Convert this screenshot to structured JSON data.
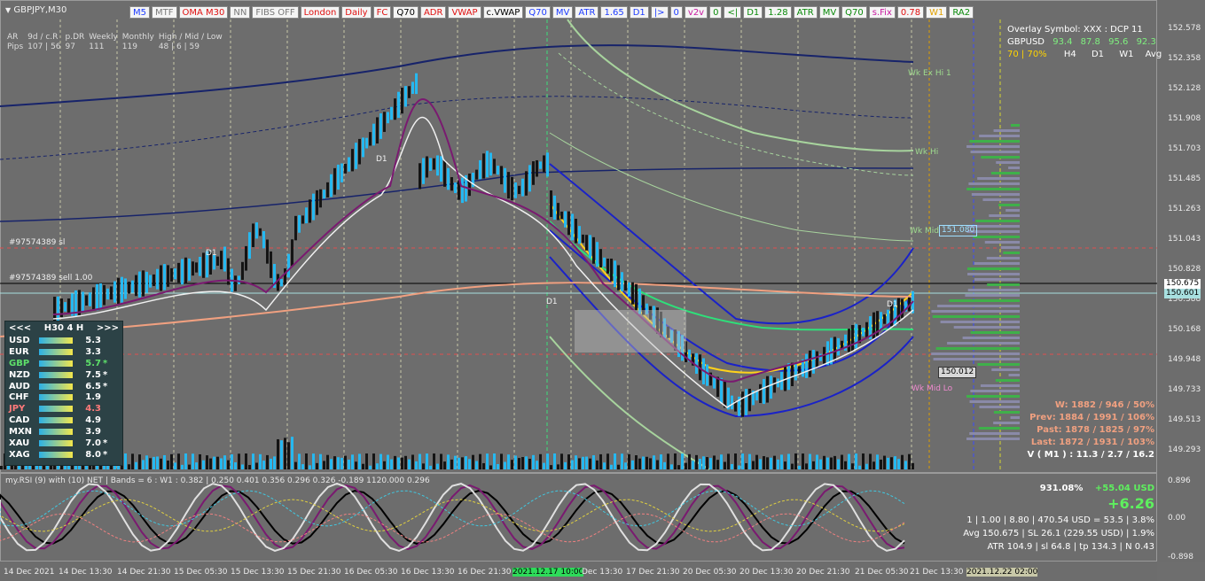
{
  "symbol_title": "GBPJPY,M30",
  "toolbar": [
    {
      "label": "M5",
      "color": "#1e3cff"
    },
    {
      "label": "MTF",
      "color": "#7a7a7a"
    },
    {
      "label": "OMA M30",
      "color": "#e01010"
    },
    {
      "label": "NN",
      "color": "#7a7a7a"
    },
    {
      "label": "FIBS OFF",
      "color": "#7a7a7a"
    },
    {
      "label": "London",
      "color": "#e01010"
    },
    {
      "label": "Daily",
      "color": "#e01010"
    },
    {
      "label": "FC",
      "color": "#e01010"
    },
    {
      "label": "Q70",
      "color": "#000000"
    },
    {
      "label": "ADR",
      "color": "#e01010"
    },
    {
      "label": "VWAP",
      "color": "#e01010"
    },
    {
      "label": "c.VWAP",
      "color": "#000000"
    },
    {
      "label": "Q70",
      "color": "#1e3cff"
    },
    {
      "label": "MV",
      "color": "#1e3cff"
    },
    {
      "label": "ATR",
      "color": "#1e3cff"
    },
    {
      "label": "1.65",
      "color": "#1e3cff"
    },
    {
      "label": "D1",
      "color": "#1e3cff"
    },
    {
      "label": "|>",
      "color": "#1e3cff"
    },
    {
      "label": "0",
      "color": "#1e3cff"
    },
    {
      "label": "v2v",
      "color": "#c81aa0"
    },
    {
      "label": "0",
      "color": "#0a8a0a"
    },
    {
      "label": "<|",
      "color": "#0a8a0a"
    },
    {
      "label": "D1",
      "color": "#0a8a0a"
    },
    {
      "label": "1.28",
      "color": "#0a8a0a"
    },
    {
      "label": "ATR",
      "color": "#0a8a0a"
    },
    {
      "label": "MV",
      "color": "#0a8a0a"
    },
    {
      "label": "Q70",
      "color": "#0a8a0a"
    },
    {
      "label": "s.Fix",
      "color": "#c81aa0"
    },
    {
      "label": "0.78",
      "color": "#e01010"
    },
    {
      "label": "W1",
      "color": "#e0a000"
    },
    {
      "label": "RA2",
      "color": "#0a8a0a"
    }
  ],
  "stats": {
    "headers": [
      "AR",
      "9d / c.R",
      "p.DR",
      "Weekly",
      "Monthly",
      "High / Mid / Low"
    ],
    "row_label": "Pips",
    "values": [
      "107 | 56",
      "97",
      "111",
      "119",
      "48 | 6 | 59"
    ]
  },
  "strength_panel": {
    "prev": "<<<",
    "timeframe": "H30 4 H",
    "next": ">>>",
    "rows": [
      {
        "cur": "USD",
        "val": "5.3",
        "flag": "",
        "color": "#ffffff"
      },
      {
        "cur": "EUR",
        "val": "3.3",
        "flag": "",
        "color": "#ffffff"
      },
      {
        "cur": "GBP",
        "val": "5.7",
        "flag": "*",
        "color": "#5ee06a"
      },
      {
        "cur": "NZD",
        "val": "7.5",
        "flag": "*",
        "color": "#ffffff"
      },
      {
        "cur": "AUD",
        "val": "6.5",
        "flag": "*",
        "color": "#ffffff"
      },
      {
        "cur": "CHF",
        "val": "1.9",
        "flag": "",
        "color": "#ffffff"
      },
      {
        "cur": "JPY",
        "val": "4.3",
        "flag": "",
        "color": "#ff7a7a"
      },
      {
        "cur": "CAD",
        "val": "4.9",
        "flag": "",
        "color": "#ffffff"
      },
      {
        "cur": "MXN",
        "val": "3.9",
        "flag": "",
        "color": "#ffffff"
      },
      {
        "cur": "XAU",
        "val": "7.0",
        "flag": "*",
        "color": "#ffffff"
      },
      {
        "cur": "XAG",
        "val": "8.0",
        "flag": "*",
        "color": "#ffffff"
      }
    ]
  },
  "overlay": {
    "line1": "Overlay Symbol: XXX : DCP 11",
    "sym": "GBPUSD",
    "v1": "93.4",
    "v2": "87.8",
    "v3": "95.6",
    "v4": "92.3",
    "pct": "70 | 70%",
    "h4": "H4",
    "d1": "D1",
    "w1": "W1",
    "avg": "Avg"
  },
  "range_stats": {
    "w": "W: 1882 / 946 / 50%",
    "prev": "Prev: 1884 / 1991 / 106%",
    "past": "Past: 1878 / 1825 / 97%",
    "last": "Last: 1872 / 1931 / 103%",
    "v": "V ( M1 ) : 11.3 / 2.7 / 16.2"
  },
  "profit": {
    "pct": "931.08%",
    "usd": "+55.04 USD",
    "big": "+6.26",
    "line1": "1 | 1.00 | 8.80 | 470.54 USD = 53.5 | 3.8%",
    "line2": "Avg 150.675 | SL 26.1 (229.55 USD) | 1.9%",
    "line3": "ATR 104.9 | sl 64.8 | tp 134.3 | N 0.43"
  },
  "chart_labels": {
    "order_sl": "#97574389 sl",
    "order_sell": "#97574389 sell 1.00",
    "wk_ex_hi": "Wk Ex Hi 1",
    "wk_hi": "Wk Hi",
    "wk_mid": "Wk Mid",
    "wk_mid_lo": "Wk Mid Lo",
    "d1_a": "D1",
    "d1_b": "D1",
    "d1_c": "D1",
    "d1_d": "D1",
    "price_box": "151.080",
    "price_box2": "150.012"
  },
  "osc_title": "my.RSI (9) with (10) NET | Bands = 6 : W1 : 0.382 | 0.250 0.401 0.356 0.296 0.326 -0.189 1120.000 0.296",
  "price_axis": [
    "152.578",
    "152.358",
    "152.128",
    "151.908",
    "151.703",
    "151.485",
    "151.263",
    "151.043",
    "150.828",
    "150.388",
    "150.168",
    "149.948",
    "149.733",
    "149.513",
    "149.293"
  ],
  "price_tags": {
    "bid": "150.675",
    "ask": "150.601"
  },
  "osc_axis": [
    "0.896",
    "0.00",
    "-0.898"
  ],
  "time_axis": [
    "14 Dec 2021",
    "14 Dec 13:30",
    "14 Dec 21:30",
    "15 Dec 05:30",
    "15 Dec 13:30",
    "15 Dec 21:30",
    "16 Dec 05:30",
    "16 Dec 13:30",
    "16 Dec 21:30",
    "2021.12.17 10:00",
    "Dec 13:30",
    "17 Dec 21:30",
    "20 Dec 05:30",
    "20 Dec 13:30",
    "20 Dec 21:30",
    "21 Dec 05:30",
    "21 Dec 13:30",
    "2021.12.22 02:00"
  ]
}
